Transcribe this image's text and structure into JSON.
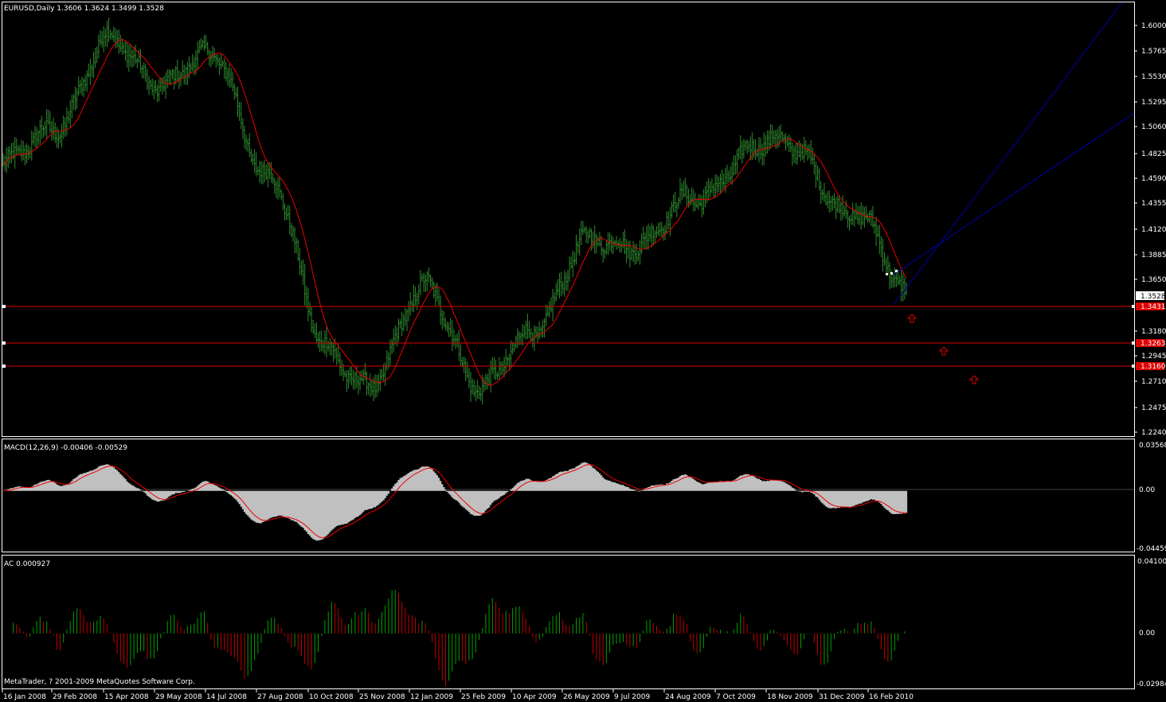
{
  "window": {
    "symbol_header": "EURUSD,Daily  1.3606 1.3624 1.3499 1.3528",
    "macd_header": "MACD(12,26,9) -0.00406 -0.00529",
    "ac_header": "AC 0.000927",
    "copyright": "MetaTrader, ? 2001-2009 MetaQuotes Software Corp."
  },
  "colors": {
    "background": "#000000",
    "frame": "#ffffff",
    "bars": "#2e8b2e",
    "moving_average": "#ff0000",
    "trendlines": "#0000a0",
    "hlines": "#ff0000",
    "macd_hist": "#c0c0c0",
    "macd_signal": "#ff0000",
    "ac_up": "#00a000",
    "ac_down": "#c00000"
  },
  "price_axis": {
    "labels": [
      "1.6000",
      "1.5765",
      "1.5530",
      "1.5295",
      "1.5060",
      "1.4825",
      "1.4590",
      "1.4355",
      "1.4120",
      "1.3885",
      "1.3650",
      "1.3180",
      "1.2945",
      "1.2710",
      "1.2475",
      "1.2240"
    ],
    "current_price": "1.3528",
    "hline_labels": [
      "1.3431",
      "1.3263",
      "1.3160"
    ]
  },
  "macd_axis": {
    "labels": [
      "0.03568",
      "0.00",
      "-0.04459"
    ]
  },
  "ac_axis": {
    "labels": [
      "0.041005",
      "0.00",
      "-0.02984"
    ]
  },
  "time_axis": {
    "labels": [
      "16 Jan 2008",
      "29 Feb 2008",
      "15 Apr 2008",
      "29 May 2008",
      "14 Jul 2008",
      "27 Aug 2008",
      "10 Oct 2008",
      "25 Nov 2008",
      "12 Jan 2009",
      "25 Feb 2009",
      "10 Apr 2009",
      "26 May 2009",
      "9 Jul 2009",
      "24 Aug 2009",
      "7 Oct 2009",
      "18 Nov 2009",
      "31 Dec 2009",
      "16 Feb 2010"
    ]
  },
  "chart_data": {
    "type": "bar",
    "symbol": "EURUSD",
    "timeframe": "Daily",
    "last_bar": {
      "open": 1.3606,
      "high": 1.3624,
      "low": 1.3499,
      "close": 1.3528
    },
    "price_range": [
      1.224,
      1.63
    ],
    "horizontal_levels": [
      1.3431,
      1.3263,
      1.316
    ],
    "close_path": {
      "dates": [
        "16 Jan 2008",
        "29 Feb 2008",
        "15 Apr 2008",
        "29 May 2008",
        "14 Jul 2008",
        "27 Aug 2008",
        "10 Oct 2008",
        "25 Nov 2008",
        "12 Jan 2009",
        "25 Feb 2009",
        "10 Apr 2009",
        "26 May 2009",
        "9 Jul 2009",
        "24 Aug 2009",
        "7 Oct 2009",
        "18 Nov 2009",
        "31 Dec 2009",
        "16 Feb 2010"
      ],
      "values": [
        1.47,
        1.52,
        1.59,
        1.56,
        1.575,
        1.47,
        1.31,
        1.27,
        1.37,
        1.26,
        1.33,
        1.4,
        1.41,
        1.44,
        1.495,
        1.49,
        1.43,
        1.36
      ]
    },
    "macd": {
      "main": -0.00406,
      "signal": -0.00529,
      "range": [
        -0.04459,
        0.03568
      ]
    },
    "ac": {
      "value": 0.000927,
      "range": [
        -0.02984,
        0.041005
      ]
    }
  }
}
